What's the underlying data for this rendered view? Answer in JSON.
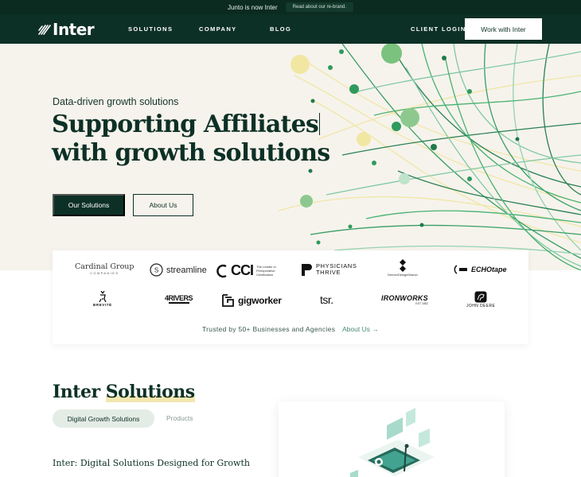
{
  "announcement": {
    "text": "Junto is now Inter",
    "link_label": "Read about our re-brand."
  },
  "header": {
    "logo_text": "Inter",
    "nav": [
      "SOLUTIONS",
      "COMPANY",
      "BLOG"
    ],
    "client_login": "CLIENT LOGIN",
    "cta": "Work with Inter"
  },
  "hero": {
    "eyebrow": "Data-driven growth solutions",
    "headline_line1": "Supporting Affiliates",
    "headline_line2": "with growth solutions",
    "primary_button": "Our Solutions",
    "secondary_button": "About Us"
  },
  "clients": {
    "logos": {
      "cardinal_group": "Cardinal Group",
      "cardinal_sub": "COMPANIES",
      "streamline": "streamline",
      "cci": "CCI",
      "cci_tag": "The Leader in Perioperative Certification",
      "physicians_1": "PHYSICIANS",
      "physicians_2": "THRIVE",
      "denver_design": "DenverDesignDistrict",
      "echotape": "ECHOtape",
      "brevite": "BREVITÉ",
      "four_rivers": "4RIVERS",
      "gigworker": "gigworker",
      "tsr": "tsr.",
      "ironworks": "IRONWORKS",
      "ironworks_sub": "EST 1852",
      "john_deere": "JOHN DEERE"
    },
    "trusted_text": "Trusted by 50+ Businesses and Agencies",
    "about_link": "About Us →"
  },
  "solutions": {
    "title_prefix": "Inter ",
    "title_highlight": "Solutions",
    "tabs": [
      "Digital Growth Solutions",
      "Products"
    ],
    "sub_heading": "Inter: Digital Solutions Designed for Growth"
  },
  "colors": {
    "brand_dark": "#0d3026",
    "hero_bg": "#f6f3ec",
    "accent_green": "#2e9a5e",
    "accent_yellow": "#f3e7a0"
  }
}
